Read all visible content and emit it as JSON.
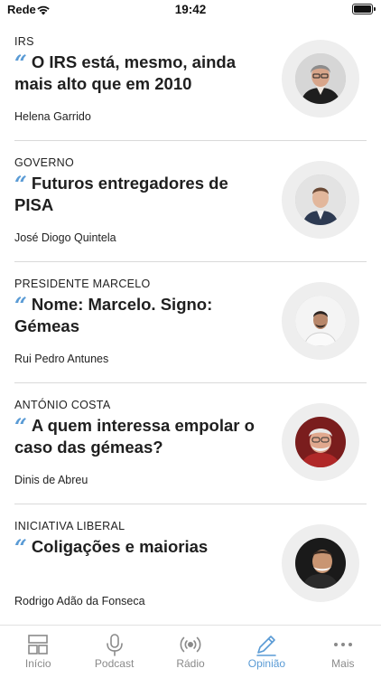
{
  "status_bar": {
    "carrier": "Rede",
    "time": "19:42"
  },
  "colors": {
    "accent": "#5a9bd5",
    "tab_inactive": "#8a8a8a",
    "divider": "#d9d9d9",
    "avatar_ring": "#eeeeee"
  },
  "articles": [
    {
      "topic": "IRS",
      "title": "O IRS está, mesmo, ainda mais alto que em 2010",
      "author": "Helena Garrido"
    },
    {
      "topic": "GOVERNO",
      "title": "Futuros entregadores de PISA",
      "author": "José Diogo Quintela"
    },
    {
      "topic": "PRESIDENTE MARCELO",
      "title": "Nome: Marcelo. Signo: Gémeas",
      "author": "Rui Pedro Antunes"
    },
    {
      "topic": "ANTÓNIO COSTA",
      "title": "A quem interessa empolar o caso das gémeas?",
      "author": "Dinis de Abreu"
    },
    {
      "topic": "INICIATIVA LIBERAL",
      "title": "Coligações e maiorias",
      "author": "Rodrigo Adão da Fonseca"
    }
  ],
  "tabs": [
    {
      "label": "Início",
      "icon": "home-grid-icon",
      "active": false
    },
    {
      "label": "Podcast",
      "icon": "microphone-icon",
      "active": false
    },
    {
      "label": "Rádio",
      "icon": "radio-broadcast-icon",
      "active": false
    },
    {
      "label": "Opinião",
      "icon": "pen-icon",
      "active": true
    },
    {
      "label": "Mais",
      "icon": "more-dots-icon",
      "active": false
    }
  ]
}
